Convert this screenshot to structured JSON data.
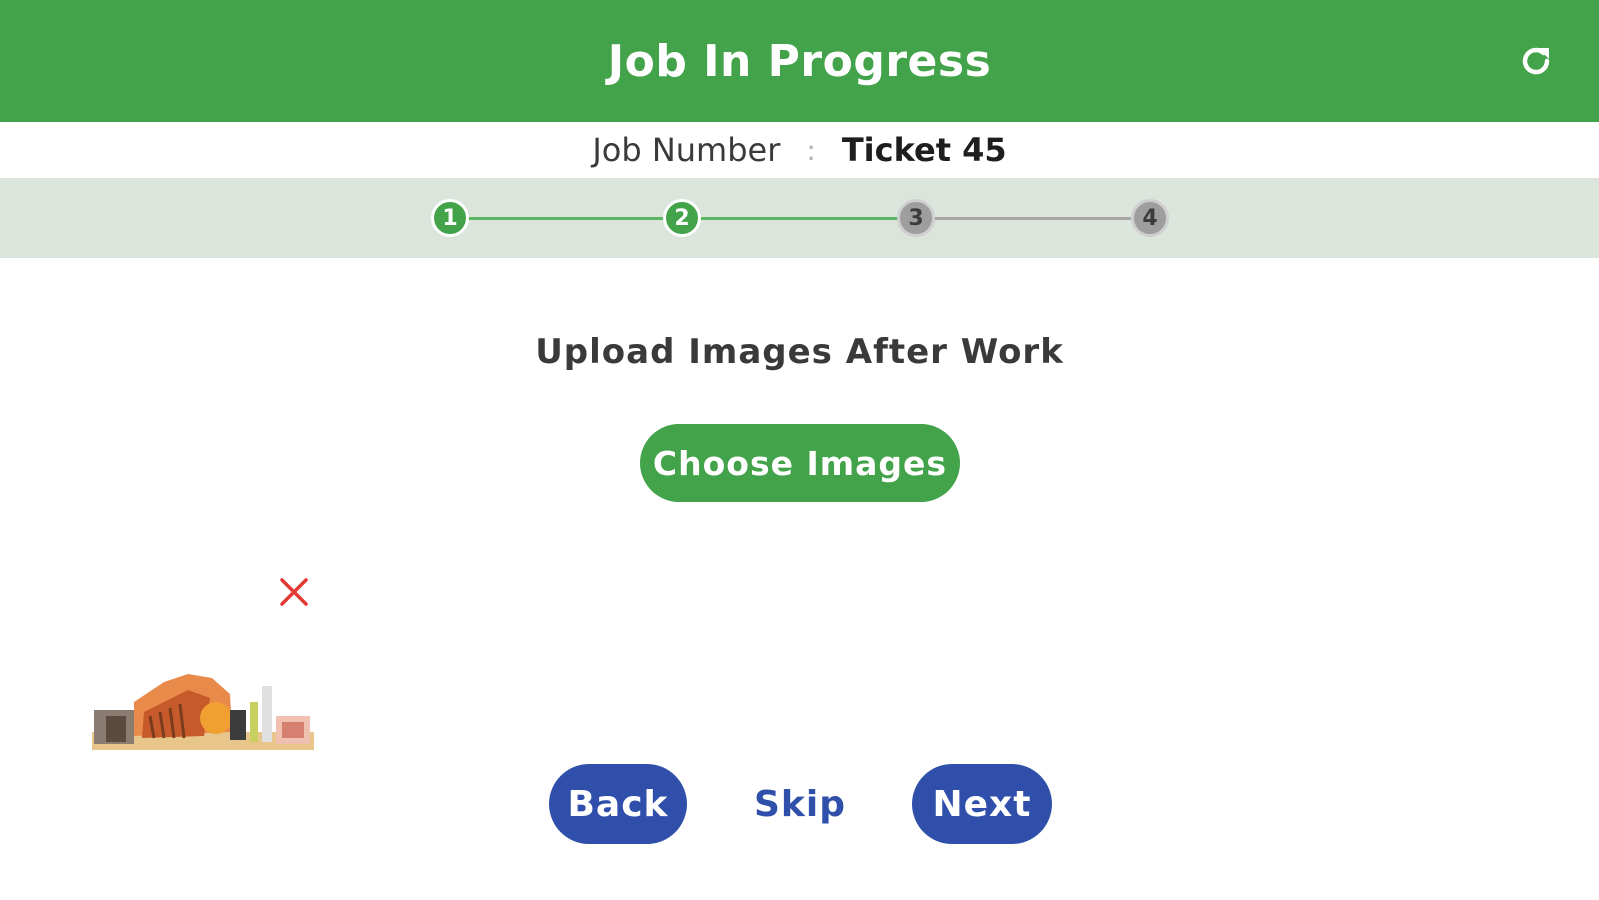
{
  "header": {
    "title": "Job In Progress",
    "refresh_icon": "refresh-icon",
    "background_color": "#43a34a"
  },
  "job": {
    "label": "Job Number",
    "separator": ":",
    "value": "Ticket 45"
  },
  "stepper": {
    "steps": [
      {
        "label": "1",
        "status": "done"
      },
      {
        "label": "2",
        "status": "done"
      },
      {
        "label": "3",
        "status": "todo"
      },
      {
        "label": "4",
        "status": "todo"
      }
    ],
    "done_color": "#43a34a",
    "todo_color": "#9e9e9e"
  },
  "upload": {
    "title": "Upload Images After Work",
    "choose_label": "Choose Images",
    "remove_icon": "close-icon",
    "remove_color": "#e53935"
  },
  "footer": {
    "back_label": "Back",
    "skip_label": "Skip",
    "next_label": "Next",
    "button_color": "#2f4faa"
  }
}
